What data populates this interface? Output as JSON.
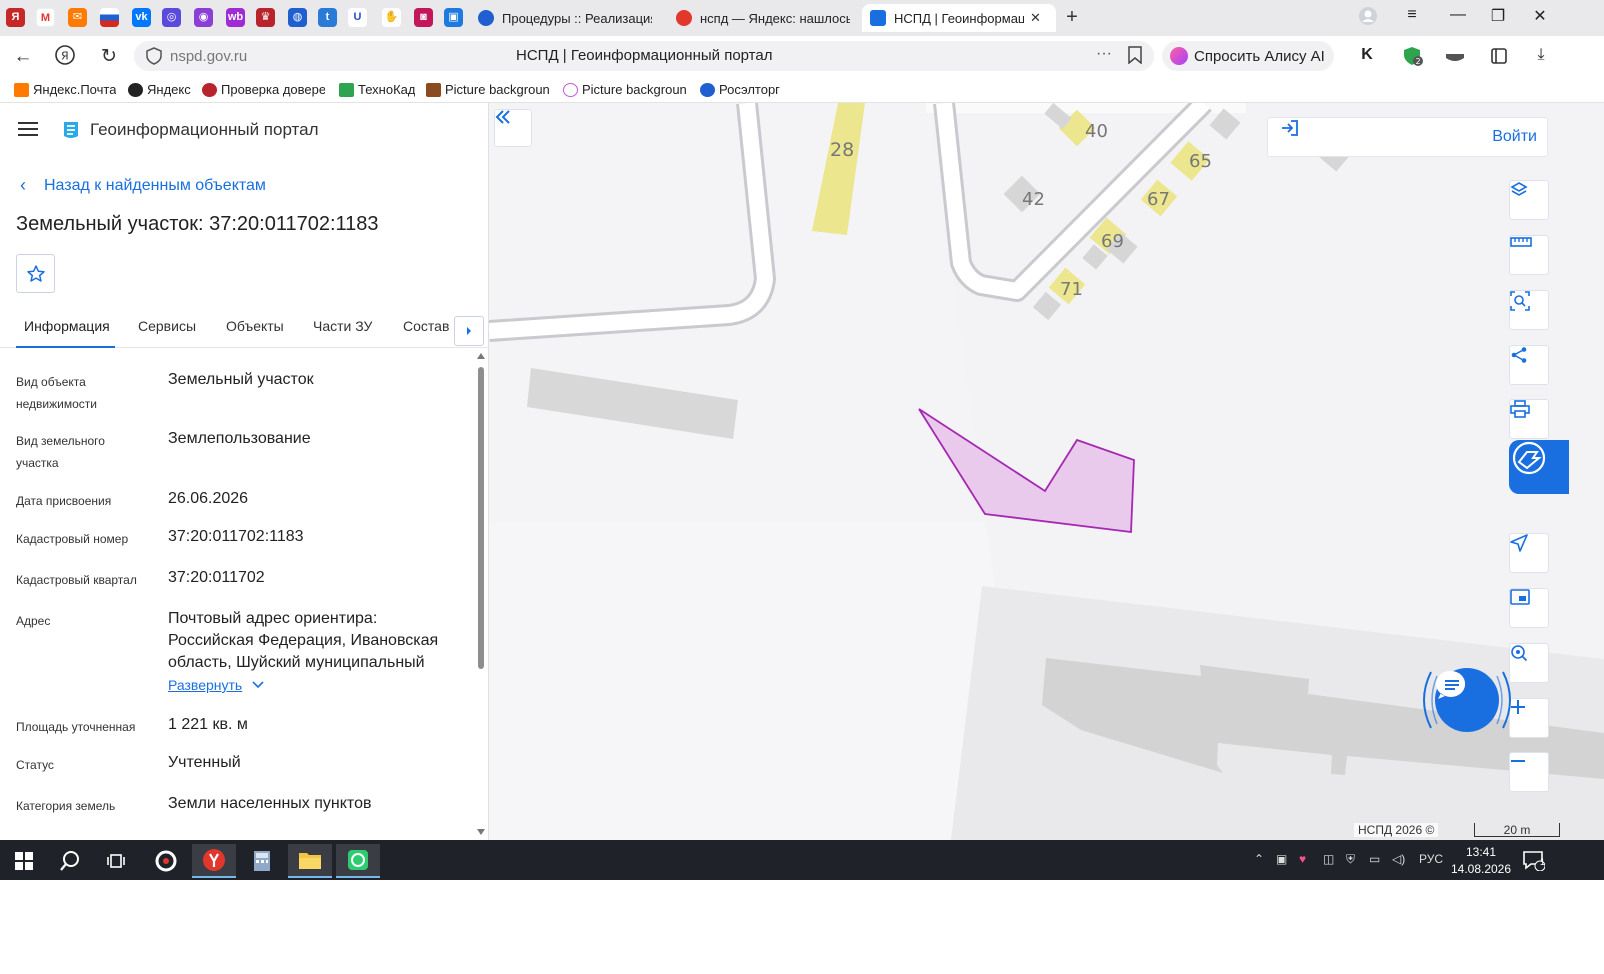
{
  "browser": {
    "tabs": [
      {
        "label": "Процедуры :: Реализация",
        "icon_color": "#1f5fcf"
      },
      {
        "label": "нспд — Яндекс: нашлось",
        "icon_color": "#e2372c"
      },
      {
        "label": "НСПД | Геоинформаци",
        "icon_color": "#1a6fe0",
        "active": true
      }
    ],
    "url": "nspd.gov.ru",
    "page_title": "НСПД | Геоинформационный портал",
    "alice_label": "Спросить Алису AI",
    "bookmarks": [
      {
        "label": "Яндекс.Почта",
        "icon_color": "#ff7a00"
      },
      {
        "label": "Яндекс",
        "icon_color": "#222222"
      },
      {
        "label": "Проверка довере",
        "icon_color": "#b8242c"
      },
      {
        "label": "ТехноКад",
        "icon_color": "#2fa44f"
      },
      {
        "label": "Picture backgroun",
        "icon_color": "#8a4b1f"
      },
      {
        "label": "Picture backgroun",
        "icon_color": "#c05bd6"
      },
      {
        "label": "Росэлторг",
        "icon_color": "#1f5fcf"
      }
    ]
  },
  "panel": {
    "portal_title": "Геоинформационный портал",
    "back_label": "Назад к найденным объектам",
    "object_title": "Земельный участок: 37:20:011702:1183",
    "tabs": [
      "Информация",
      "Сервисы",
      "Объекты",
      "Части ЗУ",
      "Состав"
    ],
    "fields": [
      {
        "label": "Вид объекта недвижимости",
        "value": "Земельный участок"
      },
      {
        "label": "Вид земельного участка",
        "value": "Землепользование"
      },
      {
        "label": "Дата присвоения",
        "value": "26.06.2026"
      },
      {
        "label": "Кадастровый номер",
        "value": "37:20:011702:1183"
      },
      {
        "label": "Кадастровый квартал",
        "value": "37:20:011702"
      },
      {
        "label": "Адрес",
        "value": "Почтовый адрес ориентира: Российская Федерация, Ивановская область, Шуйский муниципальный"
      },
      {
        "label": "Площадь уточненная",
        "value": "1 221 кв. м"
      },
      {
        "label": "Статус",
        "value": "Учтенный"
      },
      {
        "label": "Категория земель",
        "value": "Земли населенных пунктов"
      }
    ],
    "expand_label": "Развернуть"
  },
  "map": {
    "login_label": "Войти",
    "house_numbers": [
      "28",
      "40",
      "65",
      "42",
      "67",
      "69",
      "71"
    ],
    "copyright": "НСПД 2026 ©",
    "scale": "20 m",
    "colors": {
      "parcel_fill": "#e9c9ec",
      "parcel_stroke": "#a529b0",
      "accent": "#1a6fe0",
      "building": "#d6d6d6",
      "house": "#ece78f"
    }
  },
  "taskbar": {
    "lang": "РУС",
    "time": "13:41",
    "date": "14.08.2026",
    "notif_count": "1"
  }
}
